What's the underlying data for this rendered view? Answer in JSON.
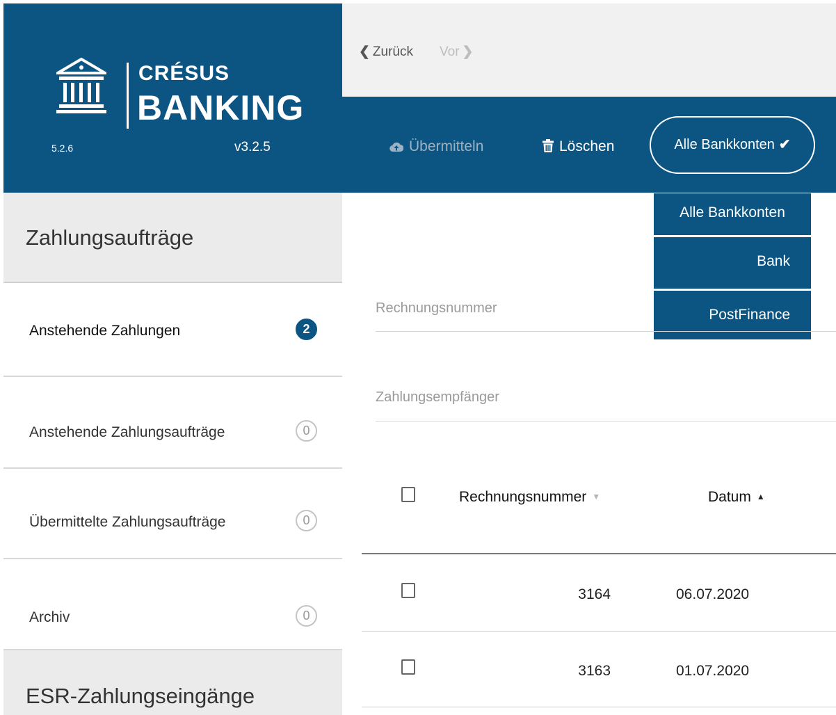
{
  "app": {
    "brand_top": "CRÉSUS",
    "brand_bottom": "BANKING",
    "version_left": "5.2.6",
    "version_right": "v3.2.5"
  },
  "nav": {
    "back_label": "Zurück",
    "forward_label": "Vor"
  },
  "toolbar": {
    "transmit_label": "Übermitteln",
    "delete_label": "Löschen",
    "account_select": "Alle Bankkonten"
  },
  "account_menu": {
    "options": [
      "Alle Bankkonten",
      "Bank",
      "PostFinance"
    ]
  },
  "sidebar": {
    "section_payments": "Zahlungsaufträge",
    "items": [
      {
        "label": "Anstehende Zahlungen",
        "count": "2"
      },
      {
        "label": "Anstehende Zahlungsaufträge",
        "count": "0"
      },
      {
        "label": "Übermittelte Zahlungsaufträge",
        "count": "0"
      },
      {
        "label": "Archiv",
        "count": "0"
      }
    ],
    "section_esr": "ESR-Zahlungseingänge"
  },
  "filters": {
    "invoice_placeholder": "Rechnungsnummer",
    "recipient_placeholder": "Zahlungsempfänger"
  },
  "table": {
    "columns": [
      "Rechnungsnummer",
      "Datum"
    ],
    "rows": [
      {
        "invoice": "3164",
        "date": "06.07.2020"
      },
      {
        "invoice": "3163",
        "date": "01.07.2020"
      }
    ]
  },
  "colors": {
    "primary": "#0c5583",
    "sidebar_header_bg": "#ebebeb",
    "nav_bg": "#f1f1f1"
  },
  "icons": {
    "logo": "bank-building-icon",
    "transmit": "cloud-upload-icon",
    "delete": "trash-icon",
    "account_select": "chevron-down-icon"
  }
}
